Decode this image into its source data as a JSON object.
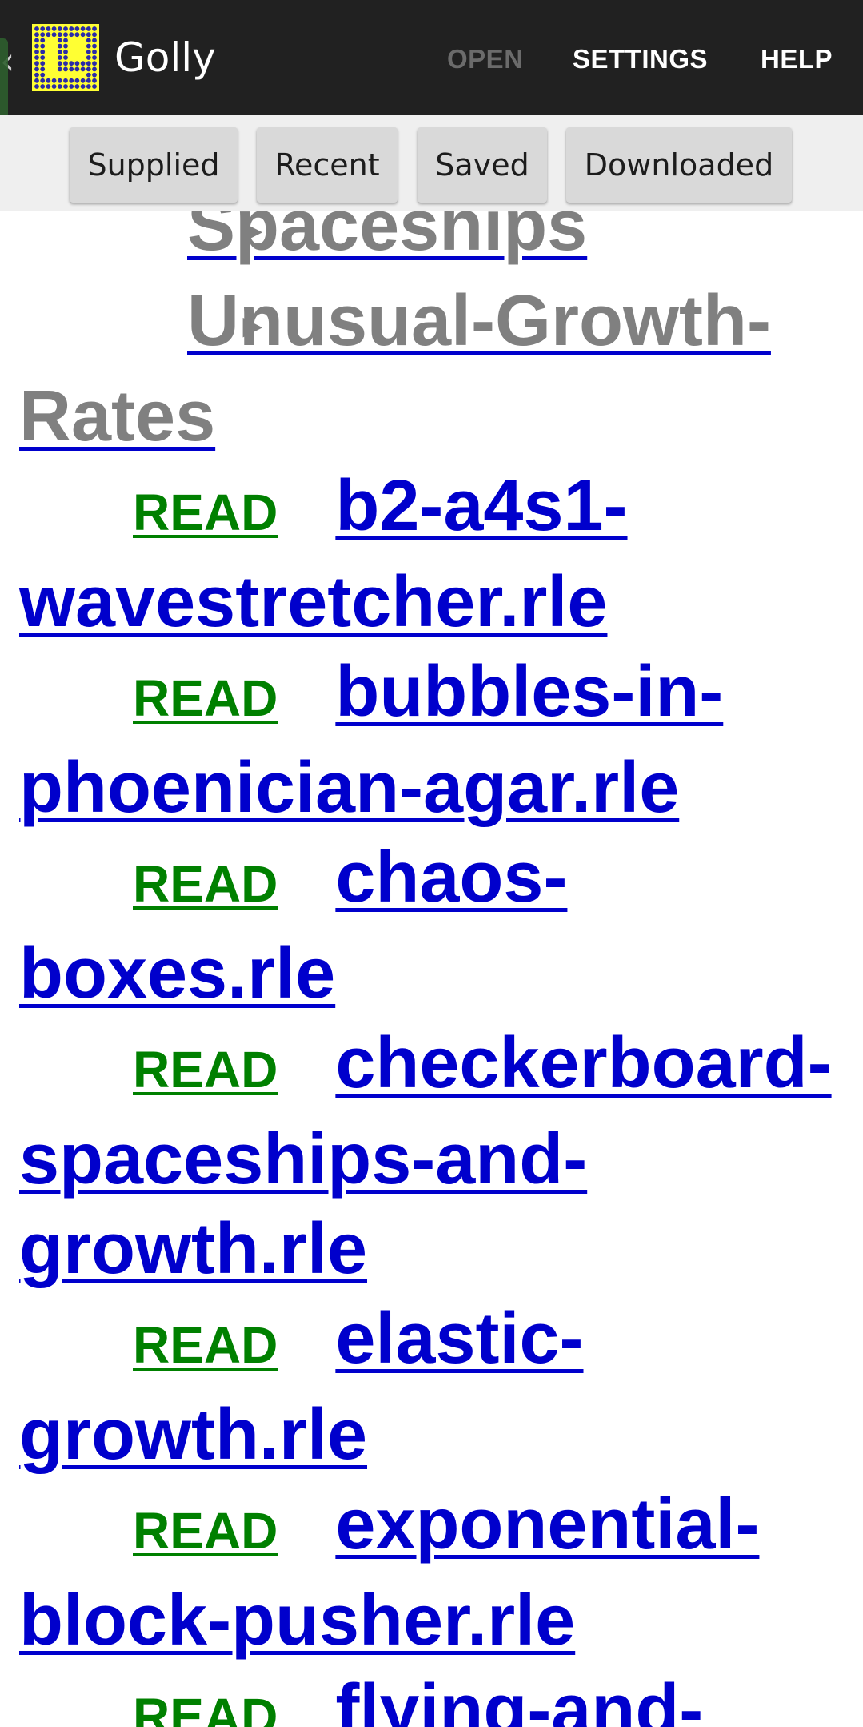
{
  "actionbar": {
    "back_glyph": "‹",
    "app_title": "Golly",
    "menu": {
      "open_label": "OPEN",
      "settings_label": "SETTINGS",
      "help_label": "HELP"
    }
  },
  "tabs": {
    "supplied_label": "Supplied",
    "recent_label": "Recent",
    "saved_label": "Saved",
    "downloaded_label": "Downloaded"
  },
  "folders": [
    {
      "name": "Spaceships"
    },
    {
      "name": "Unusual-Growth-Rates"
    }
  ],
  "read_label": "READ",
  "files": [
    {
      "name": "b2-a4s1-wavestretcher.rle"
    },
    {
      "name": "bubbles-in-phoenician-agar.rle"
    },
    {
      "name": "chaos-boxes.rle"
    },
    {
      "name": "checkerboard-spaceships-and-growth.rle"
    },
    {
      "name": "elastic-growth.rle"
    },
    {
      "name": "exponential-block-pusher.rle"
    },
    {
      "name": "flying-and-"
    }
  ],
  "colors": {
    "actionbar_bg": "#212121",
    "link_blue": "#0000cc",
    "read_green": "#008000",
    "folder_grey": "#808080",
    "icon_yellow": "#ffff33",
    "icon_blue": "#2a2aa8"
  },
  "icons": {
    "back": "chevron-left-icon",
    "app": "golly-grid-icon",
    "folder_toggle": "triangle-right-icon"
  }
}
